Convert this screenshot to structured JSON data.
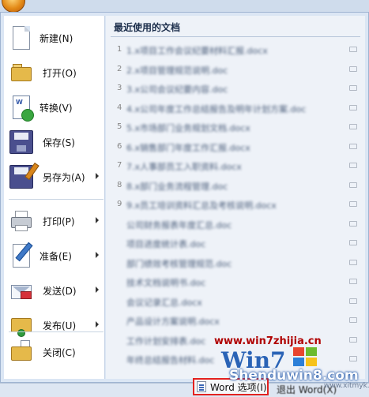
{
  "menu": {
    "commands": [
      {
        "label": "新建(N)",
        "icon": "new-document-icon",
        "has_submenu": false
      },
      {
        "label": "打开(O)",
        "icon": "open-folder-icon",
        "has_submenu": false
      },
      {
        "label": "转换(V)",
        "icon": "convert-icon",
        "has_submenu": false
      },
      {
        "label": "保存(S)",
        "icon": "save-disk-icon",
        "has_submenu": false
      },
      {
        "label": "另存为(A)",
        "icon": "save-as-icon",
        "has_submenu": true
      },
      {
        "label": "打印(P)",
        "icon": "printer-icon",
        "has_submenu": true
      },
      {
        "label": "准备(E)",
        "icon": "prepare-icon",
        "has_submenu": true
      },
      {
        "label": "发送(D)",
        "icon": "send-mail-icon",
        "has_submenu": true
      },
      {
        "label": "发布(U)",
        "icon": "publish-icon",
        "has_submenu": true
      },
      {
        "label": "关闭(C)",
        "icon": "close-folder-icon",
        "has_submenu": false
      }
    ]
  },
  "recent": {
    "title": "最近使用的文档",
    "documents": [
      {
        "num": "1",
        "name": "1.x项目工作会议纪要材料汇报.docx"
      },
      {
        "num": "2",
        "name": "2.x项目管理规范说明.doc"
      },
      {
        "num": "3",
        "name": "3.x公司会议纪要内容.doc"
      },
      {
        "num": "4",
        "name": "4.x公司年度工作总结报告及明年计划方案.doc"
      },
      {
        "num": "5",
        "name": "5.x市场部门业务规划文档.docx"
      },
      {
        "num": "6",
        "name": "6.x销售部门年度工作汇报.docx"
      },
      {
        "num": "7",
        "name": "7.x人事部员工入职资料.docx"
      },
      {
        "num": "8",
        "name": "8.x部门业务流程管理.doc"
      },
      {
        "num": "9",
        "name": "9.x员工培训资料汇总及考核说明.docx"
      },
      {
        "num": "",
        "name": "公司财务报表年度汇总.doc"
      },
      {
        "num": "",
        "name": "项目进度统计表.doc"
      },
      {
        "num": "",
        "name": "部门绩效考核管理规范.doc"
      },
      {
        "num": "",
        "name": "技术文档说明书.doc"
      },
      {
        "num": "",
        "name": "会议记录汇总.docx"
      },
      {
        "num": "",
        "name": "产品设计方案说明.docx"
      },
      {
        "num": "",
        "name": "工作计划安排表.doc"
      },
      {
        "num": "",
        "name": "年终总结报告材料.doc"
      }
    ]
  },
  "footer": {
    "word_options_label": "Word 选项(I)",
    "exit_word_label": "退出 Word(X)"
  },
  "watermark": {
    "url_top": "www.win7zhijia.cn",
    "logo": "Win7",
    "site": "Shenduwin8.com",
    "site_small": "www.xitmyk.com"
  }
}
